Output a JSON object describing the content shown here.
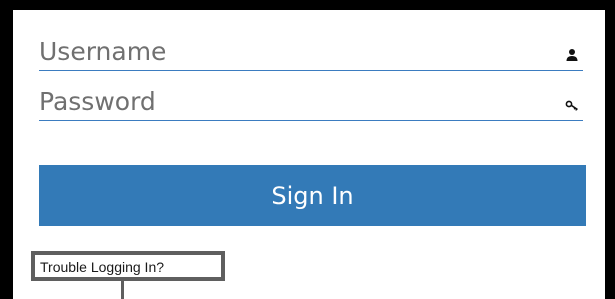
{
  "login": {
    "username_placeholder": "Username",
    "username_value": "",
    "username_icon": "user-icon",
    "password_placeholder": "Password",
    "password_value": "",
    "password_icon": "key-icon",
    "signin_label": "Sign In",
    "trouble_label": "Trouble Logging In?"
  },
  "colors": {
    "accent": "#337ab7",
    "underline": "#3b7cc0",
    "frame_border": "#000000",
    "highlight_border": "#5f5f5f"
  }
}
